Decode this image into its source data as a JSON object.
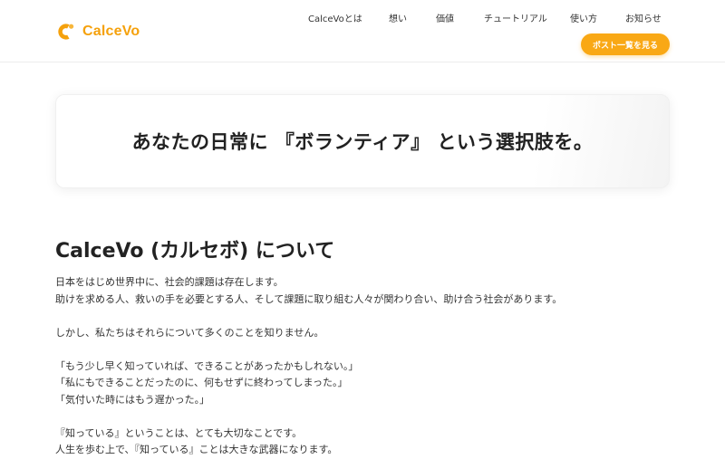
{
  "header": {
    "logo_text": "CalceVo",
    "brand_color": "#f5a10c",
    "nav": [
      {
        "label": "CalceVoとは"
      },
      {
        "label": "想い"
      },
      {
        "label": "価値"
      },
      {
        "label": "チュートリアル"
      },
      {
        "label": "使い方"
      },
      {
        "label": "お知らせ"
      }
    ],
    "cta_label": "ポスト一覧を見る",
    "cta_color": "#f9a815"
  },
  "hero": {
    "tagline": "あなたの日常に 『ボランティア』 という選択肢を。"
  },
  "about": {
    "title": "CalceVo (カルセボ) について",
    "lines": [
      "日本をはじめ世界中に、社会的課題は存在します。",
      "助けを求める人、救いの手を必要とする人、そして課題に取り組む人々が関わり合い、助け合う社会があります。",
      "",
      "しかし、私たちはそれらについて多くのことを知りません。",
      "",
      "「もう少し早く知っていれば、できることがあったかもしれない。」",
      "「私にもできることだったのに、何もせずに終わってしまった。」",
      "「気付いた時にはもう遅かった。」",
      "",
      "『知っている』ということは、とても大切なことです。",
      "人生を歩む上で、『知っている』ことは大きな武器になります。"
    ]
  }
}
